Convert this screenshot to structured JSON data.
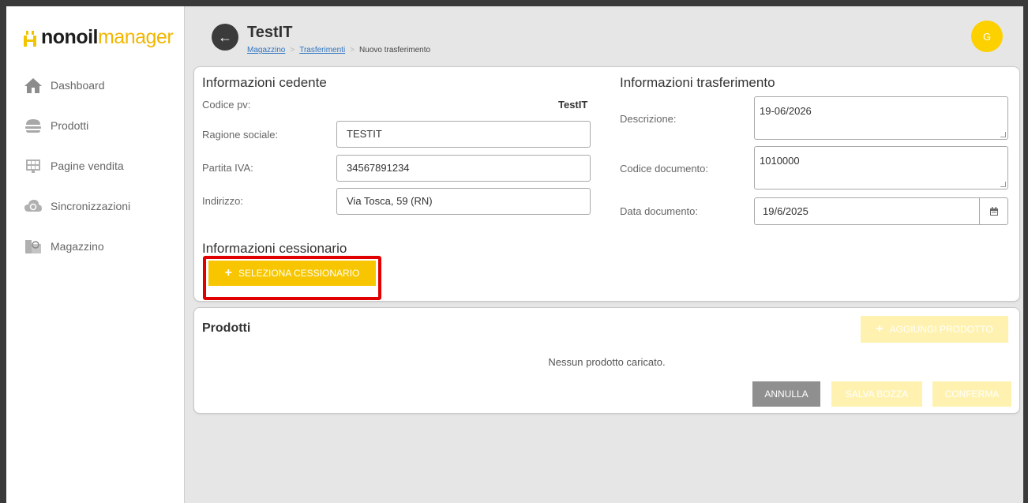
{
  "logo": {
    "part1": "nonoil",
    "part2": "manager"
  },
  "sidebar": {
    "items": [
      {
        "label": "Dashboard",
        "icon": "home-icon"
      },
      {
        "label": "Prodotti",
        "icon": "burger-icon"
      },
      {
        "label": "Pagine vendita",
        "icon": "grid-icon"
      },
      {
        "label": "Sincronizzazioni",
        "icon": "cloud-sync-icon"
      },
      {
        "label": "Magazzino",
        "icon": "warehouse-icon"
      }
    ]
  },
  "header": {
    "title": "TestIT",
    "breadcrumb": [
      "Magazzino",
      "Trasferimenti",
      "Nuovo trasferimento"
    ],
    "avatar_initial": "G"
  },
  "cedente": {
    "title": "Informazioni cedente",
    "codice_pv_label": "Codice pv:",
    "codice_pv_value": "TestIT",
    "ragione_sociale_label": "Ragione sociale:",
    "ragione_sociale_value": "TESTIT",
    "partita_iva_label": "Partita IVA:",
    "partita_iva_value": "34567891234",
    "indirizzo_label": "Indirizzo:",
    "indirizzo_value": "Via Tosca, 59 (RN)"
  },
  "trasferimento": {
    "title": "Informazioni trasferimento",
    "descrizione_label": "Descrizione:",
    "descrizione_value": "19-06/2026",
    "codice_documento_label": "Codice documento:",
    "codice_documento_value": "1010000",
    "data_documento_label": "Data documento:",
    "data_documento_value": "19/6/2025"
  },
  "cessionario": {
    "title": "Informazioni cessionario",
    "select_button": "SELEZIONA CESSIONARIO"
  },
  "prodotti": {
    "title": "Prodotti",
    "add_button": "AGGIUNGI PRODOTTO",
    "empty_message": "Nessun prodotto caricato.",
    "annulla": "ANNULLA",
    "salva_bozza": "SALVA BOZZA",
    "conferma": "CONFERMA"
  },
  "colors": {
    "accent": "#f7c600",
    "accent_disabled": "#fff2b0",
    "highlight": "#e00000",
    "secondary_button": "#8f8f8f"
  }
}
